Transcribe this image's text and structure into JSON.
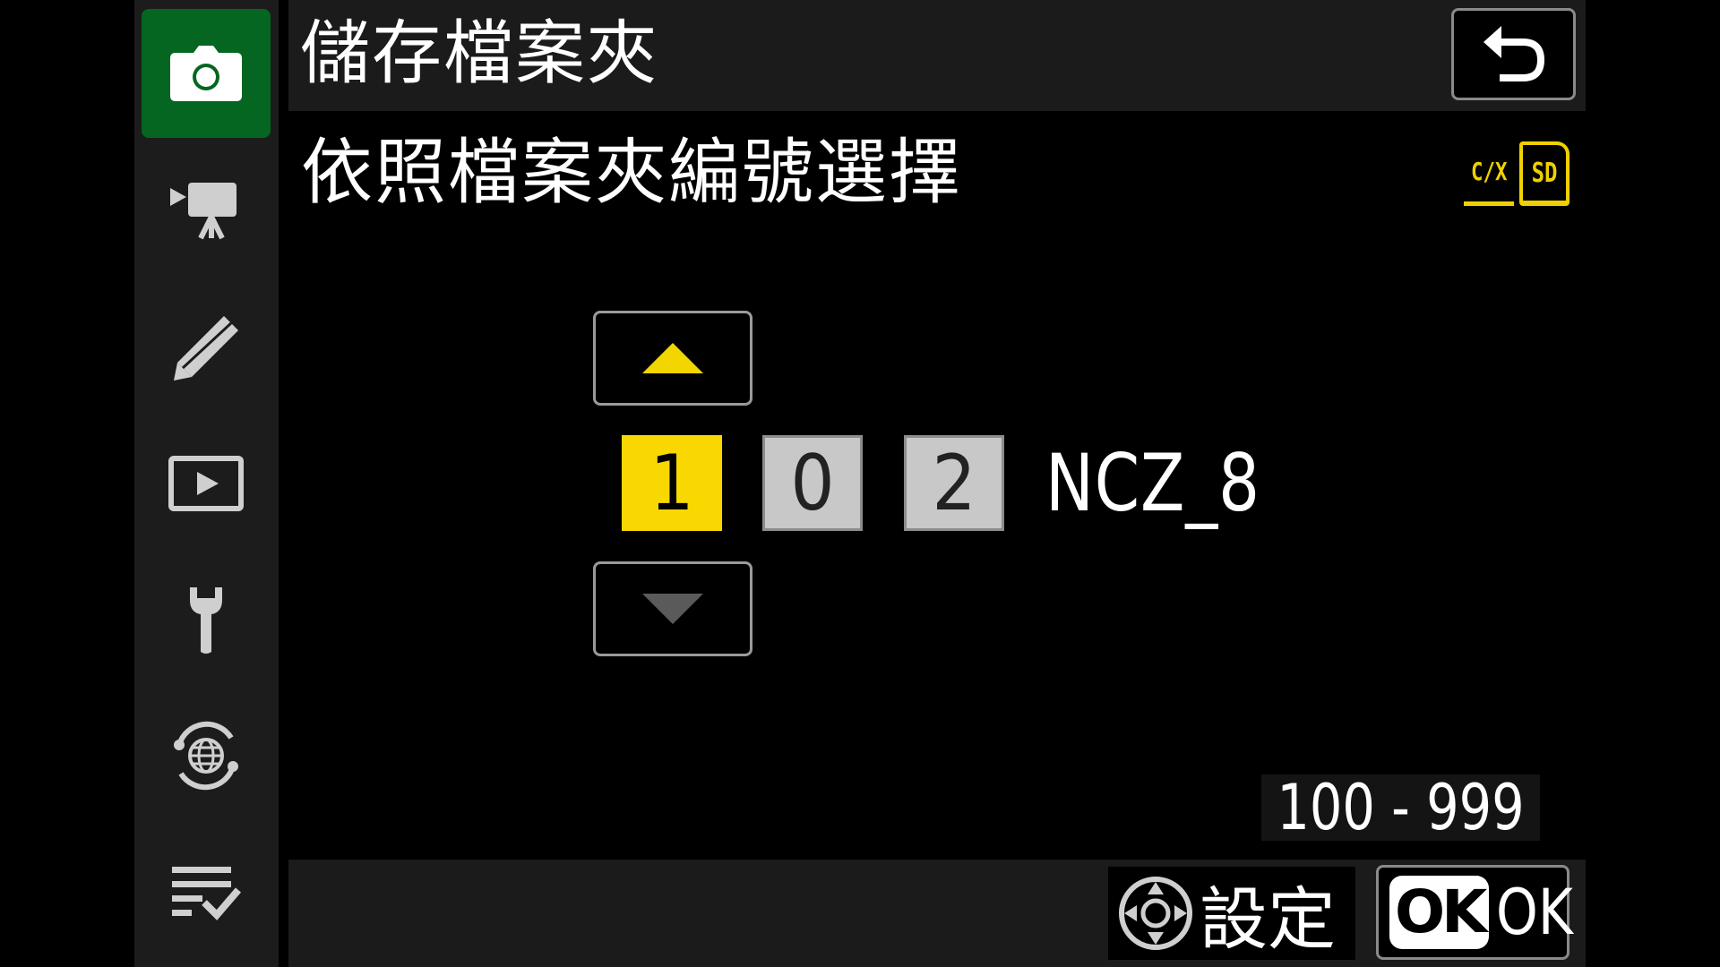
{
  "header": {
    "title": "儲存檔案夾"
  },
  "subtitle": "依照檔案夾編號選擇",
  "card_slots": {
    "slot1": "C/X",
    "slot2": "SD"
  },
  "sidebar": {
    "items": [
      {
        "name": "photo-shooting-menu",
        "icon": "camera-icon",
        "active": true
      },
      {
        "name": "video-recording-menu",
        "icon": "movie-camera-icon",
        "active": false
      },
      {
        "name": "custom-settings-menu",
        "icon": "pencil-icon",
        "active": false
      },
      {
        "name": "playback-menu",
        "icon": "playback-icon",
        "active": false
      },
      {
        "name": "setup-menu",
        "icon": "wrench-icon",
        "active": false
      },
      {
        "name": "network-menu",
        "icon": "network-globe-icon",
        "active": false
      },
      {
        "name": "my-menu",
        "icon": "my-menu-checklist-icon",
        "active": false
      }
    ]
  },
  "folder": {
    "digits": [
      "1",
      "0",
      "2"
    ],
    "selected_index": 0,
    "suffix": "NCZ_8"
  },
  "range": "100 - 999",
  "footer": {
    "set_label": "設定",
    "ok_badge": "OK",
    "ok_label": "OK"
  },
  "colors": {
    "accent_yellow": "#f8d800",
    "active_green": "#056621",
    "panel": "#1b1b1b"
  }
}
